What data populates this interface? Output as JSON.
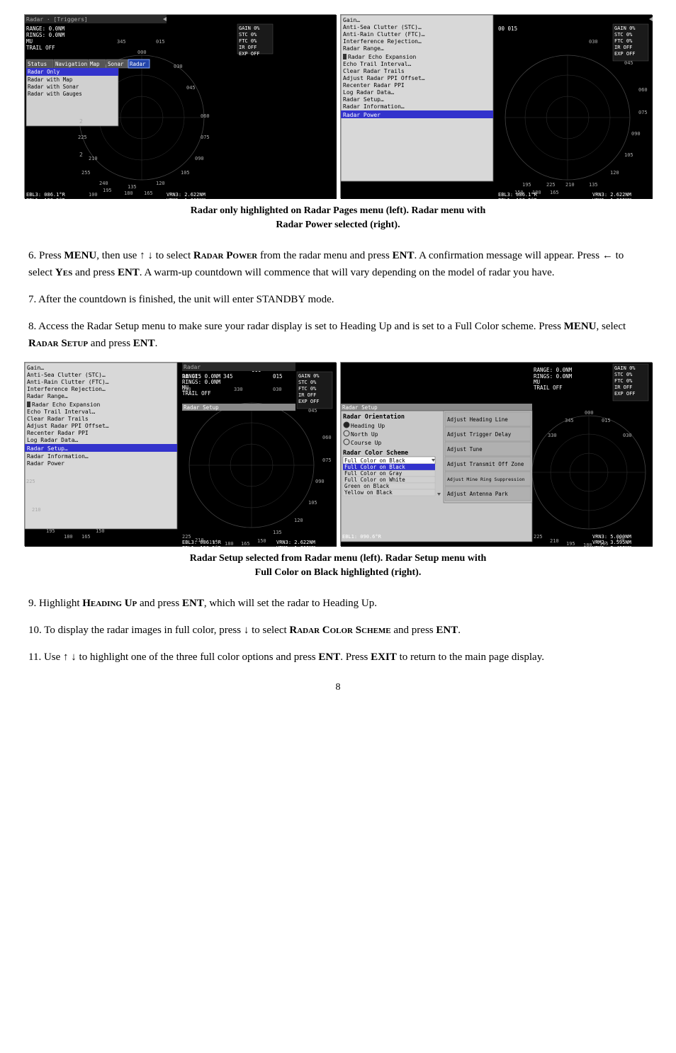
{
  "figures": {
    "fig1": {
      "caption": "Radar only highlighted on Radar Pages menu (left). Radar menu with\nRadar Power selected (right)."
    },
    "fig2": {
      "caption": "Radar Setup selected from Radar menu (left). Radar Setup menu with\nFull Color on Black highlighted (right)."
    }
  },
  "paragraphs": [
    {
      "id": "p6",
      "number": "6.",
      "text": "Press MENU, then use ↑ ↓ to select RADAR POWER from the radar menu and press ENT. A confirmation message will appear. Press ← to select YES and press ENT. A warm-up countdown will commence that will vary depending on the model of radar you have."
    },
    {
      "id": "p7",
      "number": "7.",
      "text": "After the countdown is finished, the unit will enter STANDBY mode."
    },
    {
      "id": "p8",
      "number": "8.",
      "text": "Access the Radar Setup menu to make sure your radar display is set to Heading Up and is set to a Full Color scheme. Press MENU, select RADAR SETUP and press ENT."
    },
    {
      "id": "p9",
      "number": "9.",
      "text": "Highlight HEADING UP and press ENT, which will set the radar to Heading Up."
    },
    {
      "id": "p10",
      "number": "10.",
      "text": "To display the radar images in full color, press ↓ to select RADAR COLOR SCHEME and press ENT."
    },
    {
      "id": "p11",
      "number": "11.",
      "text": "Use ↑ ↓ to highlight one of the three full color options and press ENT. Press EXIT to return to the main page display."
    }
  ],
  "radarSetup": {
    "colorScheme": {
      "options": [
        "Full Color on Black",
        "Full Color on Black",
        "Full Color on Gray",
        "Full Color on White",
        "Green on Black",
        "Yellow on Black"
      ],
      "highlighted": "Full Color on Black"
    }
  },
  "menu": {
    "leftItems": [
      "Gain…",
      "Anti-Sea Clutter (STC)…",
      "Anti-Rain Clutter (FTC)…",
      "Interference Rejection…",
      "Radar Range…",
      "Radar Echo Expansion",
      "Echo Trail Interval…",
      "Clear Radar Trails",
      "Adjust Radar PPI Offset…",
      "Recenter Radar PPI",
      "Log Radar Data…",
      "Radar Setup…",
      "Radar Information…",
      "Radar Power"
    ],
    "rightMenuItems": [
      "Gain…",
      "Anti-Sea Clutter (STC)…",
      "Anti-Rain Clutter (FTC)…",
      "Interference Rejection…",
      "Radar Range…",
      "Radar Echo Expansion",
      "Echo Trail Interval…",
      "Clear Radar Trails",
      "Adjust Radar PPI Offset…",
      "Recenter Radar PPI",
      "Log Radar Data…",
      "Radar Setup…",
      "Radar Information…",
      "Radar Power"
    ]
  },
  "radarPages": {
    "tabs": [
      "Status",
      "Navigation",
      "Map",
      "Sonar",
      "Radar"
    ],
    "subItems": [
      "Radar Only",
      "Radar with Map",
      "Radar with Sonar",
      "Radar with Gauges"
    ]
  },
  "pageNumber": "8"
}
